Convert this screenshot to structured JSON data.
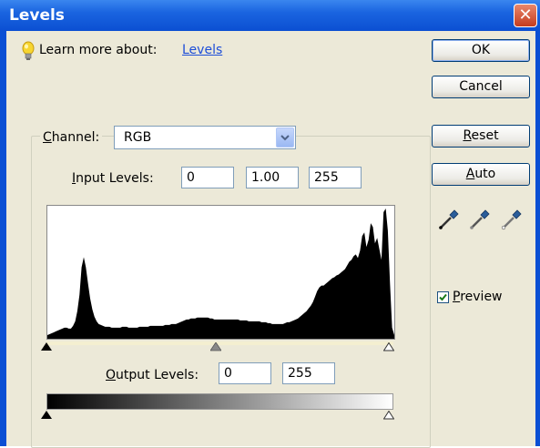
{
  "window": {
    "title": "Levels",
    "close_glyph": "✕"
  },
  "learn": {
    "prefix": "Learn more about:",
    "link": "Levels"
  },
  "channel": {
    "label_first": "C",
    "label_rest": "hannel:",
    "value": "RGB"
  },
  "input_levels": {
    "label_first": "I",
    "label_rest": "nput Levels:",
    "black": "0",
    "gamma": "1.00",
    "white": "255"
  },
  "output_levels": {
    "label_first": "O",
    "label_rest": "utput Levels:",
    "black": "0",
    "white": "255"
  },
  "buttons": {
    "ok": "OK",
    "cancel": "Cancel",
    "reset_first": "R",
    "reset_rest": "eset",
    "auto_first": "A",
    "auto_rest": "uto"
  },
  "preview": {
    "label_first": "P",
    "label_rest": "review",
    "checked": true
  },
  "icons": [
    "lightbulb-icon",
    "black-eyedropper-icon",
    "gray-eyedropper-icon",
    "white-eyedropper-icon",
    "checkmark-icon",
    "dropdown-arrow-icon"
  ],
  "histogram": {
    "values": [
      4,
      5,
      6,
      7,
      8,
      9,
      10,
      11,
      12,
      12,
      11,
      11,
      14,
      19,
      30,
      48,
      78,
      89,
      78,
      60,
      44,
      32,
      24,
      19,
      16,
      15,
      14,
      13,
      13,
      13,
      12,
      12,
      12,
      12,
      12,
      13,
      13,
      13,
      12,
      12,
      12,
      12,
      12,
      13,
      13,
      13,
      13,
      13,
      14,
      14,
      14,
      14,
      14,
      14,
      14,
      15,
      15,
      15,
      16,
      16,
      16,
      17,
      18,
      19,
      20,
      21,
      21,
      22,
      22,
      22,
      23,
      23,
      23,
      23,
      23,
      23,
      22,
      22,
      21,
      21,
      21,
      21,
      21,
      21,
      21,
      21,
      21,
      21,
      21,
      21,
      20,
      20,
      20,
      20,
      19,
      19,
      19,
      19,
      19,
      19,
      18,
      18,
      18,
      17,
      17,
      16,
      16,
      16,
      16,
      16,
      16,
      17,
      18,
      18,
      19,
      20,
      21,
      22,
      24,
      26,
      28,
      30,
      33,
      36,
      40,
      46,
      52,
      56,
      58,
      58,
      60,
      62,
      64,
      66,
      67,
      69,
      70,
      72,
      74,
      76,
      80,
      84,
      86,
      90,
      92,
      88,
      96,
      112,
      116,
      100,
      108,
      126,
      122,
      104,
      110,
      98,
      86,
      138,
      142,
      118,
      60,
      12,
      4
    ]
  },
  "colors": {
    "titlebar": "#0b4fd2",
    "dialog_bg": "#ece9d8",
    "link": "#1d4ed8",
    "check": "#1a7a1a"
  }
}
